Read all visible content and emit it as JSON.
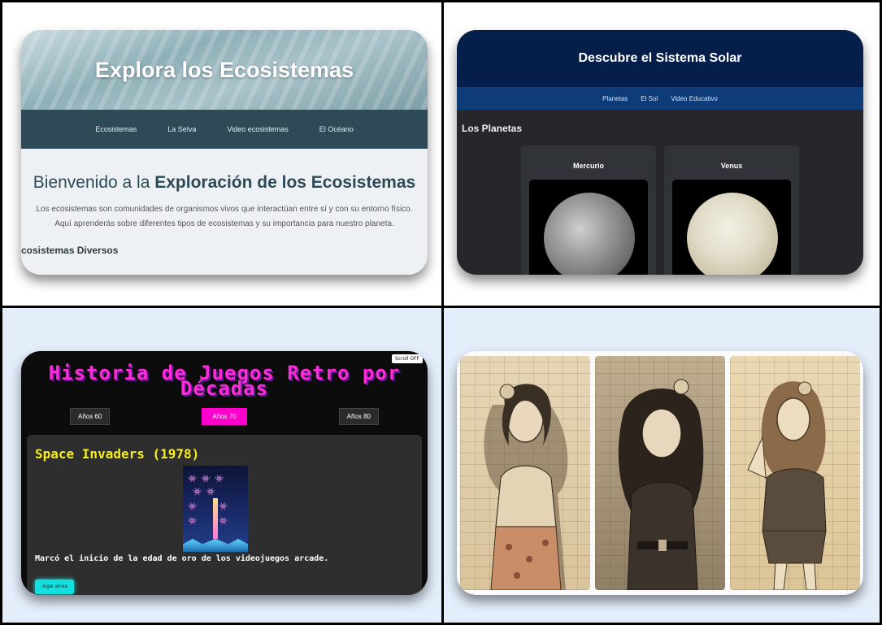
{
  "ecosystems": {
    "hero_title": "Explora los Ecosistemas",
    "nav": [
      "Ecosistemas",
      "La Selva",
      "Video ecosistemas",
      "El Océano"
    ],
    "heading_prefix": "Bienvenido a la ",
    "heading_bold": "Exploración de los Ecosistemas",
    "intro_line1": "Los ecosistemas son comunidades de organismos vivos que interactúan entre sí y con su entorno físico.",
    "intro_line2": "Aquí aprenderás sobre diferentes tipos de ecosistemas y su importancia para nuestro planeta.",
    "subheading": "Ecosistemas Diversos"
  },
  "solar": {
    "title": "Descubre el Sistema Solar",
    "nav": [
      "Planetas",
      "El Sol",
      "Video Educativo"
    ],
    "section_title": "Los Planetas",
    "planets": [
      "Mercurio",
      "Venus"
    ]
  },
  "retro": {
    "badge": "Scroll OFF",
    "title_line1": "Historia de Juegos Retro por",
    "title_line2": "Décadas",
    "tabs": [
      "Años 60",
      "Años 70",
      "Años 80"
    ],
    "active_tab": "Años 70",
    "game_title": "Space Invaders (1978)",
    "description": "Marcó el inicio de la edad de oro de los videojuegos arcade.",
    "play_button": "Jugar ahora"
  },
  "colors": {
    "eco_nav": "#2d4a56",
    "solar_header": "#061f4a",
    "retro_title": "#ff2bd6",
    "retro_game_title": "#f6ef1c",
    "retro_play": "#14e0e0"
  }
}
